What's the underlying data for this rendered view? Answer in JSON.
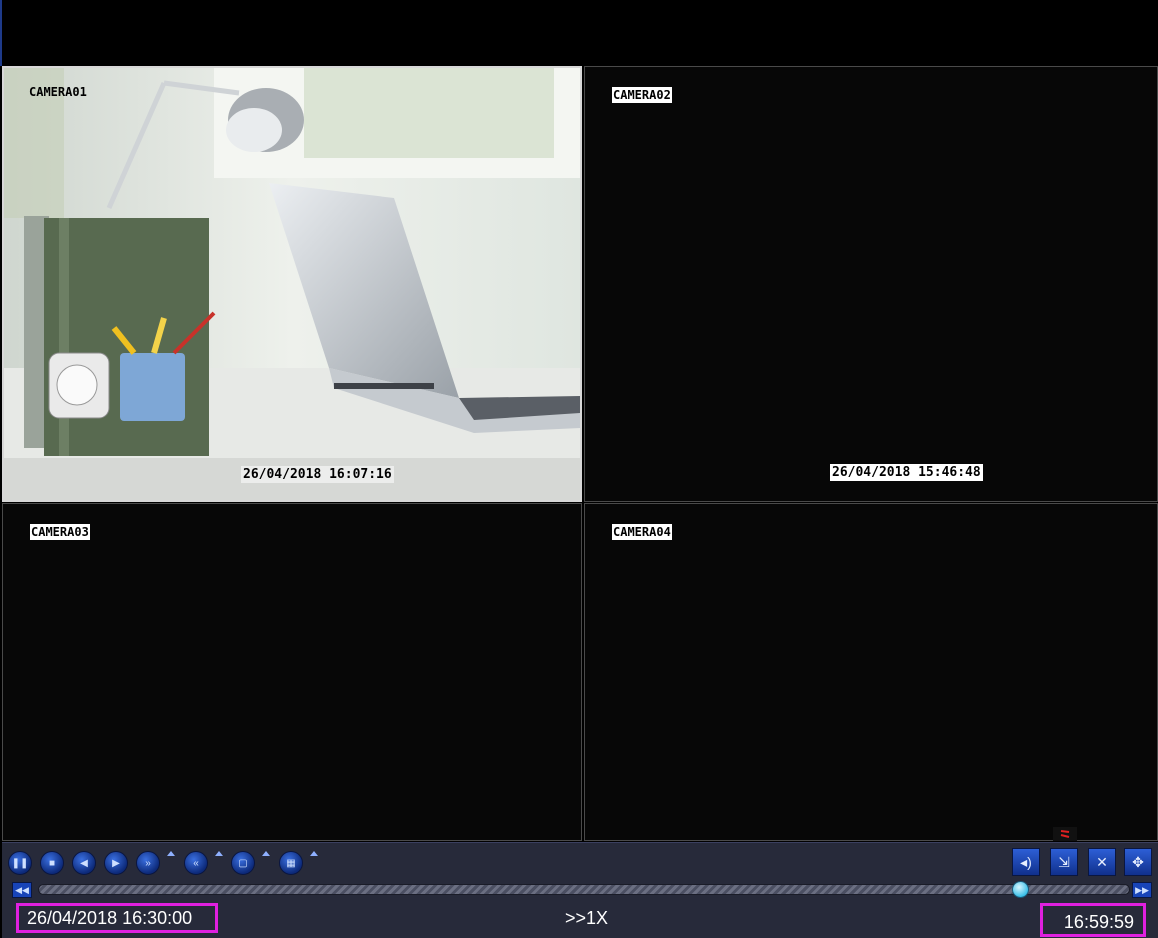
{
  "cameras": [
    {
      "label": "CAMERA01",
      "timestamp": "26/04/2018 16:07:16"
    },
    {
      "label": "CAMERA02",
      "timestamp": "26/04/2018 15:46:48"
    },
    {
      "label": "CAMERA03",
      "timestamp": ""
    },
    {
      "label": "CAMERA04",
      "timestamp": ""
    }
  ],
  "playback": {
    "start_time": "26/04/2018 16:30:00",
    "end_time": "16:59:59",
    "speed": ">>1X",
    "progress_fraction": 0.9
  },
  "icons": {
    "left_controls": [
      "pause-icon",
      "stop-icon",
      "step-back-icon",
      "step-forward-icon",
      "fast-forward-icon",
      "rewind-icon",
      "fullscreen-icon",
      "split-view-icon"
    ],
    "right_controls": [
      "volume-icon",
      "backup-icon",
      "close-icon",
      "move-icon"
    ],
    "track_edges": [
      "skip-to-start-icon",
      "skip-to-end-icon"
    ]
  },
  "colors": {
    "highlight_box": "#e020e0",
    "button_blue": "#1844b8",
    "thumb": "#3cc0e8"
  }
}
